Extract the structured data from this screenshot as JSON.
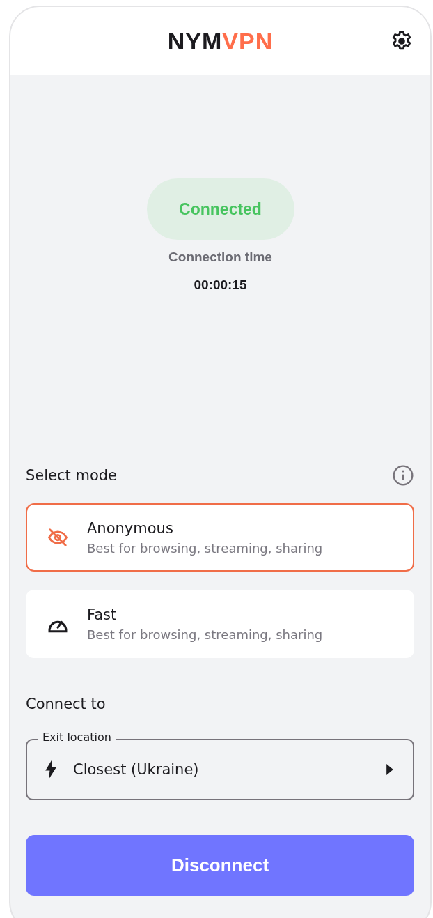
{
  "header": {
    "logo": [
      {
        "text": "NYM",
        "color": "#1c1b1f"
      },
      {
        "text": "VPN",
        "color": "#ff6e4b"
      }
    ]
  },
  "status": {
    "label": "Connected",
    "connected": true,
    "time_label": "Connection time",
    "time": "00:00:15"
  },
  "mode": {
    "title": "Select mode",
    "options": [
      {
        "kind": "anonymous",
        "title": "Anonymous",
        "subtitle": "Best for browsing, streaming, sharing",
        "selected": true
      },
      {
        "kind": "fast",
        "title": "Fast",
        "subtitle": "Best for browsing, streaming, sharing",
        "selected": false
      }
    ]
  },
  "connect": {
    "title": "Connect to",
    "field_label": "Exit location",
    "value": "Closest (Ukraine)"
  },
  "action": {
    "label": "Disconnect"
  }
}
